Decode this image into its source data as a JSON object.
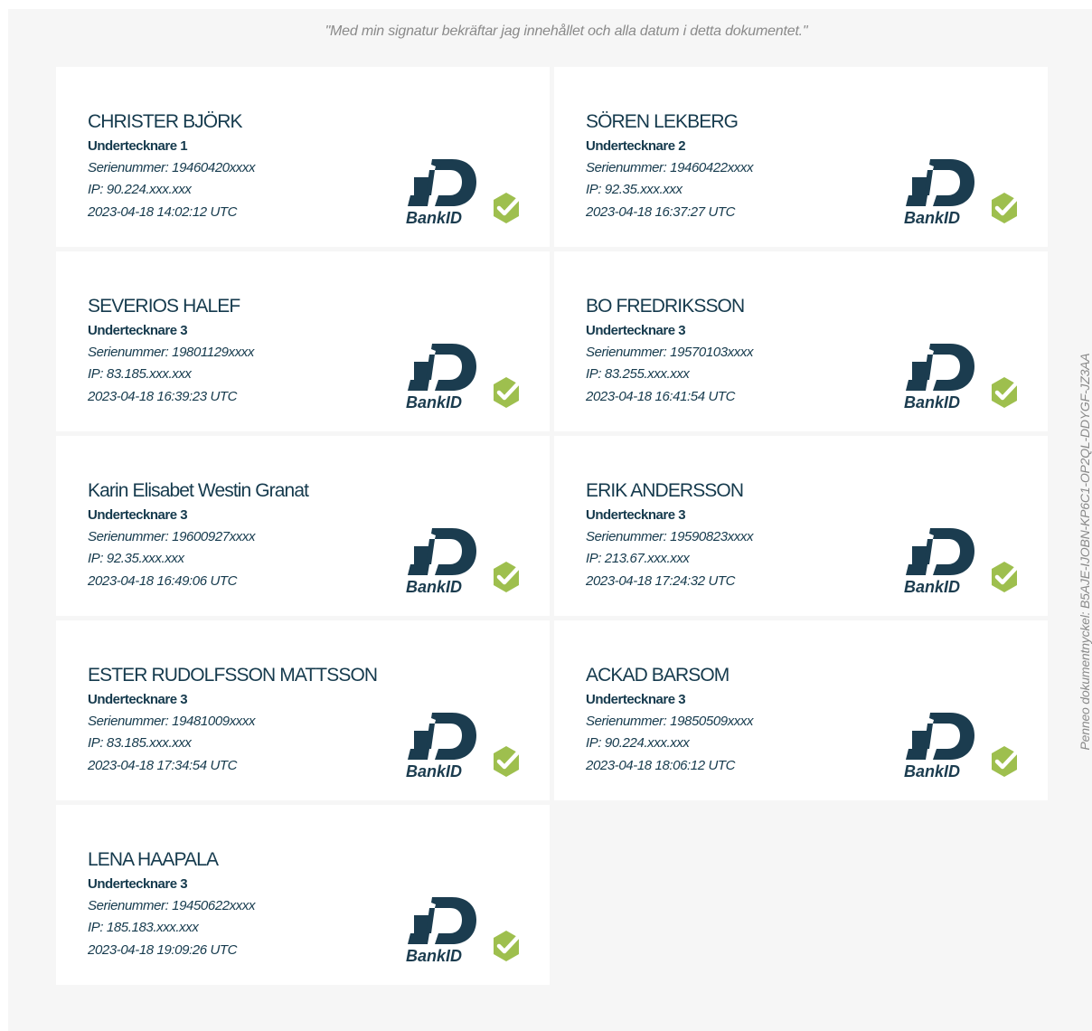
{
  "document": {
    "signature_statement": "\"Med min signatur bekräftar jag innehållet och alla datum i detta dokumentet.\"",
    "document_key_label": "Penneo dokumentnyckel: B5AJE-IJOBN-KP6C1-OP2QL-DDYGF-JZ3AA"
  },
  "colors": {
    "text_primary": "#153a4d",
    "muted": "#8a8a8a",
    "verified_check": "#9ebf4e",
    "bankid": "#1b3c4f"
  },
  "icons": {
    "provider_logo": "bankid-logo-icon",
    "verified": "verified-check-icon"
  },
  "signers": [
    {
      "name": "CHRISTER BJÖRK",
      "role": "Undertecknare 1",
      "serial": "Serienummer: 19460420xxxx",
      "ip": "IP: 90.224.xxx.xxx",
      "timestamp": "2023-04-18 14:02:12 UTC",
      "logo_text": "BankID"
    },
    {
      "name": "SÖREN LEKBERG",
      "role": "Undertecknare 2",
      "serial": "Serienummer: 19460422xxxx",
      "ip": "IP: 92.35.xxx.xxx",
      "timestamp": "2023-04-18 16:37:27 UTC",
      "logo_text": "BankID"
    },
    {
      "name": "SEVERIOS HALEF",
      "role": "Undertecknare 3",
      "serial": "Serienummer: 19801129xxxx",
      "ip": "IP: 83.185.xxx.xxx",
      "timestamp": "2023-04-18 16:39:23 UTC",
      "logo_text": "BankID"
    },
    {
      "name": "BO FREDRIKSSON",
      "role": "Undertecknare 3",
      "serial": "Serienummer: 19570103xxxx",
      "ip": "IP: 83.255.xxx.xxx",
      "timestamp": "2023-04-18 16:41:54 UTC",
      "logo_text": "BankID"
    },
    {
      "name": "Karin Elisabet Westin Granat",
      "role": "Undertecknare 3",
      "serial": "Serienummer: 19600927xxxx",
      "ip": "IP: 92.35.xxx.xxx",
      "timestamp": "2023-04-18 16:49:06 UTC",
      "logo_text": "BankID"
    },
    {
      "name": "ERIK ANDERSSON",
      "role": "Undertecknare 3",
      "serial": "Serienummer: 19590823xxxx",
      "ip": "IP: 213.67.xxx.xxx",
      "timestamp": "2023-04-18 17:24:32 UTC",
      "logo_text": "BankID"
    },
    {
      "name": "ESTER RUDOLFSSON MATTSSON",
      "role": "Undertecknare 3",
      "serial": "Serienummer: 19481009xxxx",
      "ip": "IP: 83.185.xxx.xxx",
      "timestamp": "2023-04-18 17:34:54 UTC",
      "logo_text": "BankID"
    },
    {
      "name": "ACKAD BARSOM",
      "role": "Undertecknare 3",
      "serial": "Serienummer: 19850509xxxx",
      "ip": "IP: 90.224.xxx.xxx",
      "timestamp": "2023-04-18 18:06:12 UTC",
      "logo_text": "BankID"
    },
    {
      "name": "LENA HAAPALA",
      "role": "Undertecknare 3",
      "serial": "Serienummer: 19450622xxxx",
      "ip": "IP: 185.183.xxx.xxx",
      "timestamp": "2023-04-18 19:09:26 UTC",
      "logo_text": "BankID"
    }
  ]
}
